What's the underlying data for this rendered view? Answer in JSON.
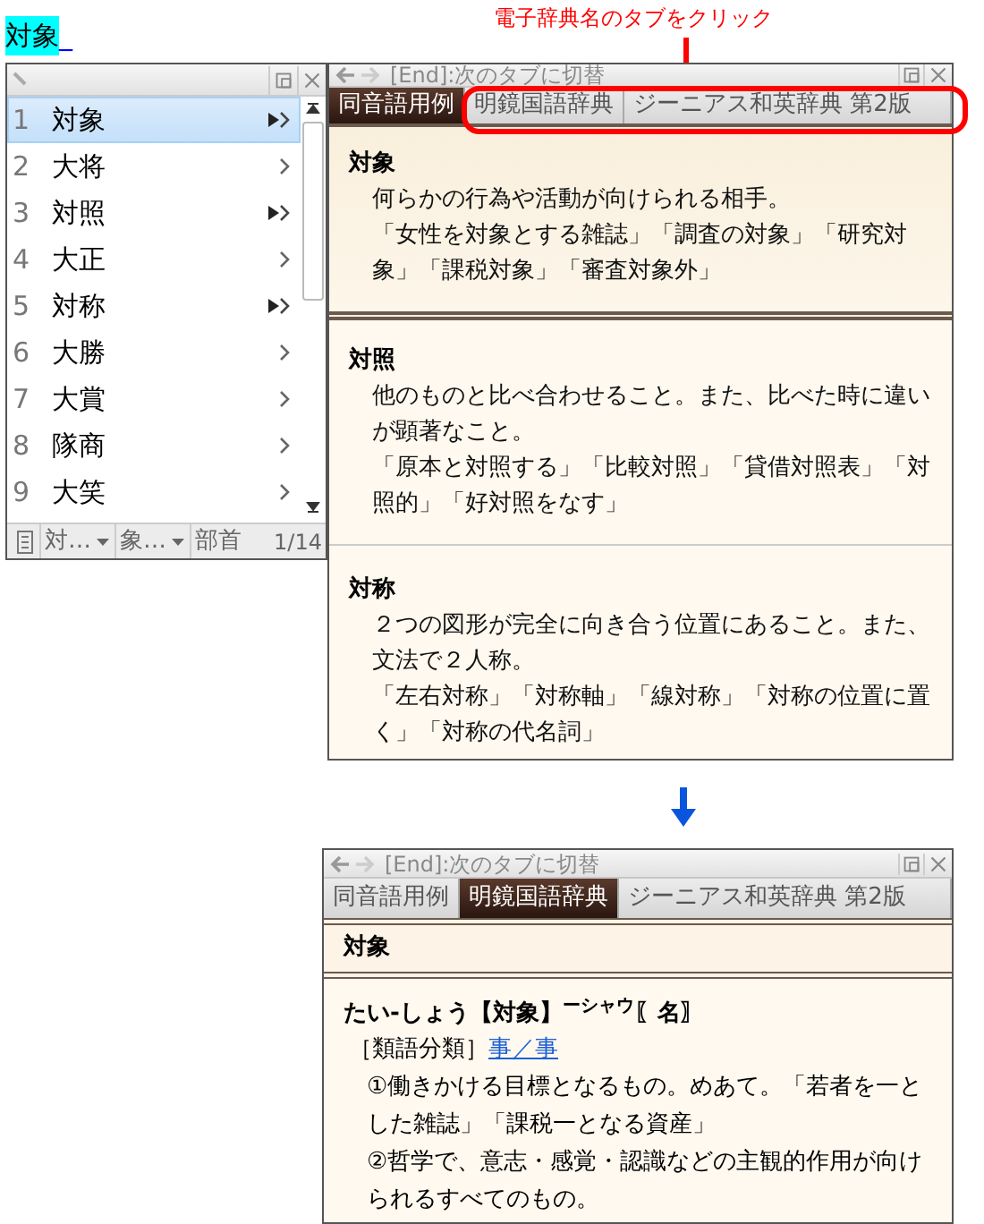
{
  "annotation": {
    "text": "電子辞典名のタブをクリック"
  },
  "input": {
    "text": "対象",
    "cursor": "_"
  },
  "candidate_window": {
    "candidates": [
      {
        "number": "1",
        "text": "対象",
        "kind": "double",
        "selected": true
      },
      {
        "number": "2",
        "text": "大将",
        "kind": "single",
        "selected": false
      },
      {
        "number": "3",
        "text": "対照",
        "kind": "double",
        "selected": false
      },
      {
        "number": "4",
        "text": "大正",
        "kind": "single",
        "selected": false
      },
      {
        "number": "5",
        "text": "対称",
        "kind": "double",
        "selected": false
      },
      {
        "number": "6",
        "text": "大勝",
        "kind": "single",
        "selected": false
      },
      {
        "number": "7",
        "text": "大賞",
        "kind": "single",
        "selected": false
      },
      {
        "number": "8",
        "text": "隊商",
        "kind": "single",
        "selected": false
      },
      {
        "number": "9",
        "text": "大笑",
        "kind": "single",
        "selected": false
      }
    ],
    "footer": {
      "fields": [
        {
          "label": "対",
          "sub": "…"
        },
        {
          "label": "象",
          "sub": "…"
        }
      ],
      "radical": "部首",
      "page": "1/14"
    }
  },
  "dictionary_before": {
    "title": "[End]:次のタブに切替",
    "tabs": [
      {
        "label": "同音語用例",
        "selected": true
      },
      {
        "label": "明鏡国語辞典",
        "selected": false
      },
      {
        "label": "ジーニアス和英辞典 第2版",
        "selected": false
      }
    ],
    "entries": [
      {
        "heading": "対象",
        "lines": [
          "何らかの行為や活動が向けられる相手。",
          "「女性を対象とする雑誌」「調査の対象」「研究対象」「課税対象」「審査対象外」"
        ]
      },
      {
        "heading": "対照",
        "lines": [
          "他のものと比べ合わせること。また、比べた時に違いが顕著なこと。",
          "「原本と対照する」「比較対照」「貸借対照表」「対照的」「好対照をなす」"
        ]
      },
      {
        "heading": "対称",
        "lines": [
          "２つの図形が完全に向き合う位置にあること。また、文法で２人称。",
          "「左右対称」「対称軸」「線対称」「対称の位置に置く」「対称の代名詞」"
        ]
      }
    ]
  },
  "dictionary_after": {
    "title": "[End]:次のタブに切替",
    "tabs": [
      {
        "label": "同音語用例",
        "selected": false
      },
      {
        "label": "明鏡国語辞典",
        "selected": true
      },
      {
        "label": "ジーニアス和英辞典 第2版",
        "selected": false
      }
    ],
    "header": "対象",
    "entry": {
      "headline": "たい-しょう【対象】$^{ーシャウ}$〖名〗",
      "category": "［類語分類］",
      "link": "事／事",
      "senses": [
        "①働きかける目標となるもの。めあて。「若者を一とした雑誌」「課税一となる資産」",
        "②哲学で、意志・感覚・認識などの主観的作用が向けられるすべてのもの。"
      ]
    }
  }
}
